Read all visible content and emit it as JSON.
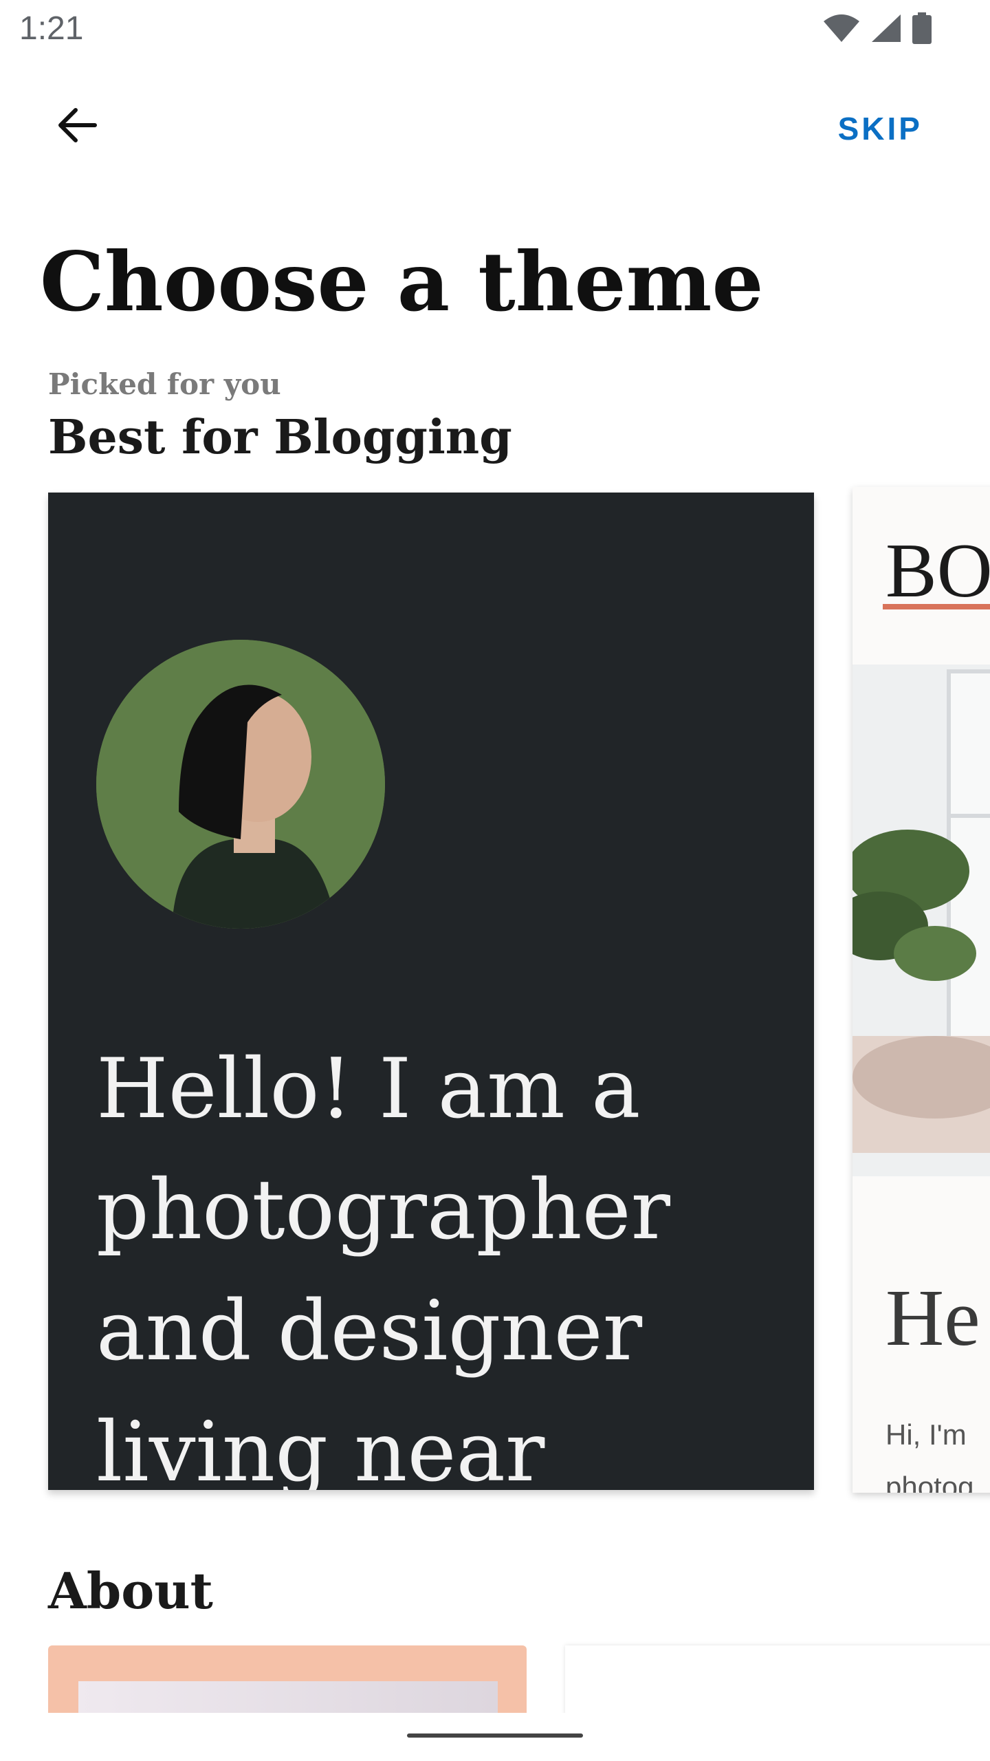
{
  "status_bar": {
    "time": "1:21",
    "icons": [
      "wifi-icon",
      "signal-icon",
      "battery-icon"
    ]
  },
  "header": {
    "back_icon": "arrow-left-icon",
    "skip_label": "SKIP"
  },
  "page": {
    "title": "Choose a theme"
  },
  "section": {
    "subtitle": "Picked for you",
    "title": "Best for Blogging"
  },
  "themes": [
    {
      "hero_text": "Hello! I am a photographer and designer living near"
    },
    {
      "title": "BO",
      "heading": "He",
      "body_line1": "Hi, I'm",
      "body_line2": "photog"
    }
  ],
  "about": {
    "title": "About"
  },
  "colors": {
    "accent": "#0b6fc4",
    "dark_card": "#212528",
    "peach": "#f5c1a8",
    "underline": "#d8735a"
  }
}
